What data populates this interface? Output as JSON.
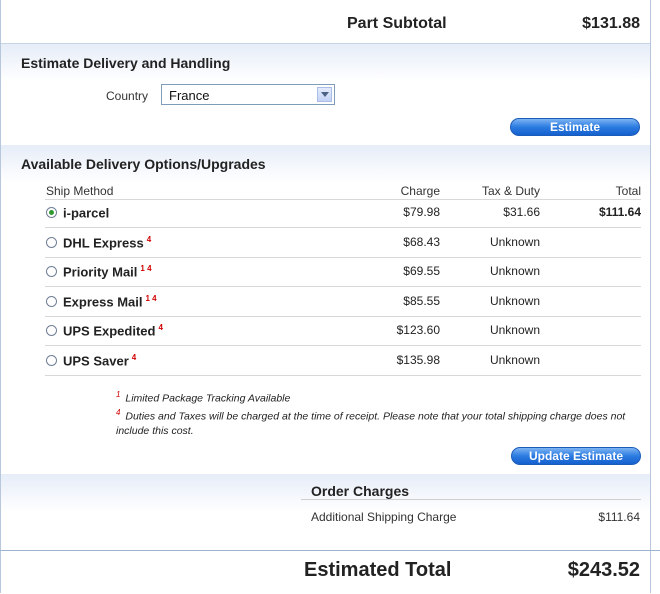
{
  "part_subtotal": {
    "label": "Part Subtotal",
    "value": "$131.88"
  },
  "estimate_delivery": {
    "title": "Estimate Delivery and Handling",
    "country_label": "Country",
    "country_value": "France",
    "button": "Estimate"
  },
  "delivery_options": {
    "title": "Available Delivery Options/Upgrades",
    "columns": {
      "method": "Ship Method",
      "charge": "Charge",
      "tax": "Tax & Duty",
      "total": "Total"
    },
    "rows": [
      {
        "name": "i-parcel",
        "sup": "",
        "charge": "$79.98",
        "tax": "$31.66",
        "total": "$111.64",
        "selected": true
      },
      {
        "name": "DHL Express",
        "sup": "4",
        "charge": "$68.43",
        "tax": "Unknown",
        "total": "",
        "selected": false
      },
      {
        "name": "Priority Mail",
        "sup": "1 4",
        "charge": "$69.55",
        "tax": "Unknown",
        "total": "",
        "selected": false
      },
      {
        "name": "Express Mail",
        "sup": "1 4",
        "charge": "$85.55",
        "tax": "Unknown",
        "total": "",
        "selected": false
      },
      {
        "name": "UPS Expedited",
        "sup": "4",
        "charge": "$123.60",
        "tax": "Unknown",
        "total": "",
        "selected": false
      },
      {
        "name": "UPS Saver",
        "sup": "4",
        "charge": "$135.98",
        "tax": "Unknown",
        "total": "",
        "selected": false
      }
    ],
    "footnotes": [
      {
        "mark": "1",
        "text": "Limited Package Tracking Available"
      },
      {
        "mark": "4",
        "text": "Duties and Taxes will be charged at the time of receipt. Please note that your total shipping charge does not include this cost."
      }
    ],
    "button": "Update Estimate"
  },
  "order_charges": {
    "title": "Order Charges",
    "item_label": "Additional Shipping Charge",
    "item_value": "$111.64"
  },
  "estimated_total": {
    "label": "Estimated Total",
    "value": "$243.52"
  },
  "colors": {
    "accent": "#2b7be0",
    "footnote_mark": "#d00000",
    "radio_selected": "#2f9b2f"
  }
}
